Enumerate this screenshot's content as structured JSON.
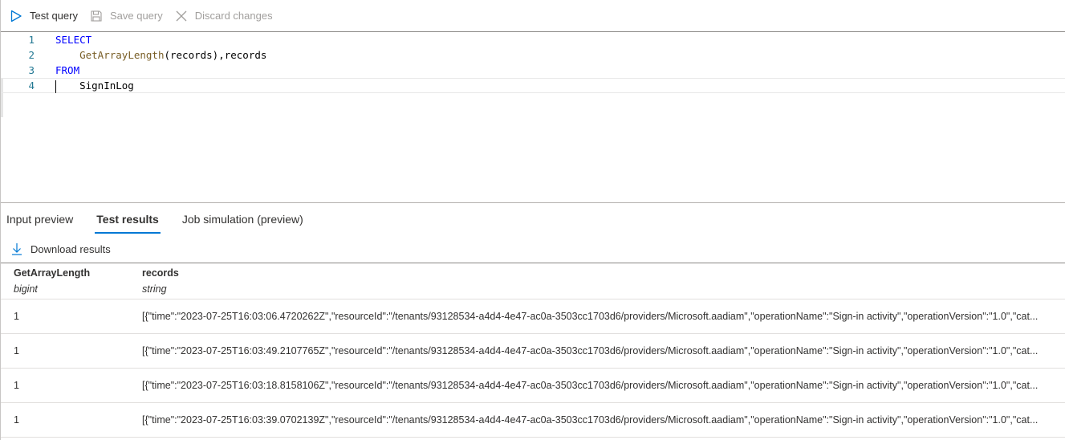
{
  "toolbar": {
    "test_query": "Test query",
    "save_query": "Save query",
    "discard_changes": "Discard changes"
  },
  "editor": {
    "lines": [
      {
        "number": "1",
        "parts": [
          {
            "text": "SELECT",
            "cls": "kw"
          }
        ]
      },
      {
        "number": "2",
        "parts": [
          {
            "text": "    ",
            "cls": ""
          },
          {
            "text": "GetArrayLength",
            "cls": "fn"
          },
          {
            "text": "(records),records",
            "cls": ""
          }
        ]
      },
      {
        "number": "3",
        "parts": [
          {
            "text": "FROM",
            "cls": "kw"
          }
        ]
      },
      {
        "number": "4",
        "parts": [
          {
            "text": "    SignInLog",
            "cls": ""
          }
        ]
      }
    ],
    "current_line": 4
  },
  "tabs": [
    {
      "label": "Input preview",
      "active": false
    },
    {
      "label": "Test results",
      "active": true
    },
    {
      "label": "Job simulation (preview)",
      "active": false
    }
  ],
  "download": {
    "label": "Download results"
  },
  "grid": {
    "columns": [
      {
        "name": "GetArrayLength",
        "type": "bigint"
      },
      {
        "name": "records",
        "type": "string"
      }
    ],
    "rows": [
      {
        "length": "1",
        "records": "[{\"time\":\"2023-07-25T16:03:06.4720262Z\",\"resourceId\":\"/tenants/93128534-a4d4-4e47-ac0a-3503cc1703d6/providers/Microsoft.aadiam\",\"operationName\":\"Sign-in activity\",\"operationVersion\":\"1.0\",\"cat..."
      },
      {
        "length": "1",
        "records": "[{\"time\":\"2023-07-25T16:03:49.2107765Z\",\"resourceId\":\"/tenants/93128534-a4d4-4e47-ac0a-3503cc1703d6/providers/Microsoft.aadiam\",\"operationName\":\"Sign-in activity\",\"operationVersion\":\"1.0\",\"cat..."
      },
      {
        "length": "1",
        "records": "[{\"time\":\"2023-07-25T16:03:18.8158106Z\",\"resourceId\":\"/tenants/93128534-a4d4-4e47-ac0a-3503cc1703d6/providers/Microsoft.aadiam\",\"operationName\":\"Sign-in activity\",\"operationVersion\":\"1.0\",\"cat..."
      },
      {
        "length": "1",
        "records": "[{\"time\":\"2023-07-25T16:03:39.0702139Z\",\"resourceId\":\"/tenants/93128534-a4d4-4e47-ac0a-3503cc1703d6/providers/Microsoft.aadiam\",\"operationName\":\"Sign-in activity\",\"operationVersion\":\"1.0\",\"cat..."
      }
    ]
  },
  "colors": {
    "accent": "#0078d4",
    "keyword": "#0000ff",
    "function": "#795e26",
    "line_number": "#237893",
    "disabled_text": "#a19f9d"
  },
  "icons": {
    "test_query": "play-icon",
    "save_query": "save-icon",
    "discard_changes": "close-icon",
    "download": "download-arrow-icon"
  }
}
